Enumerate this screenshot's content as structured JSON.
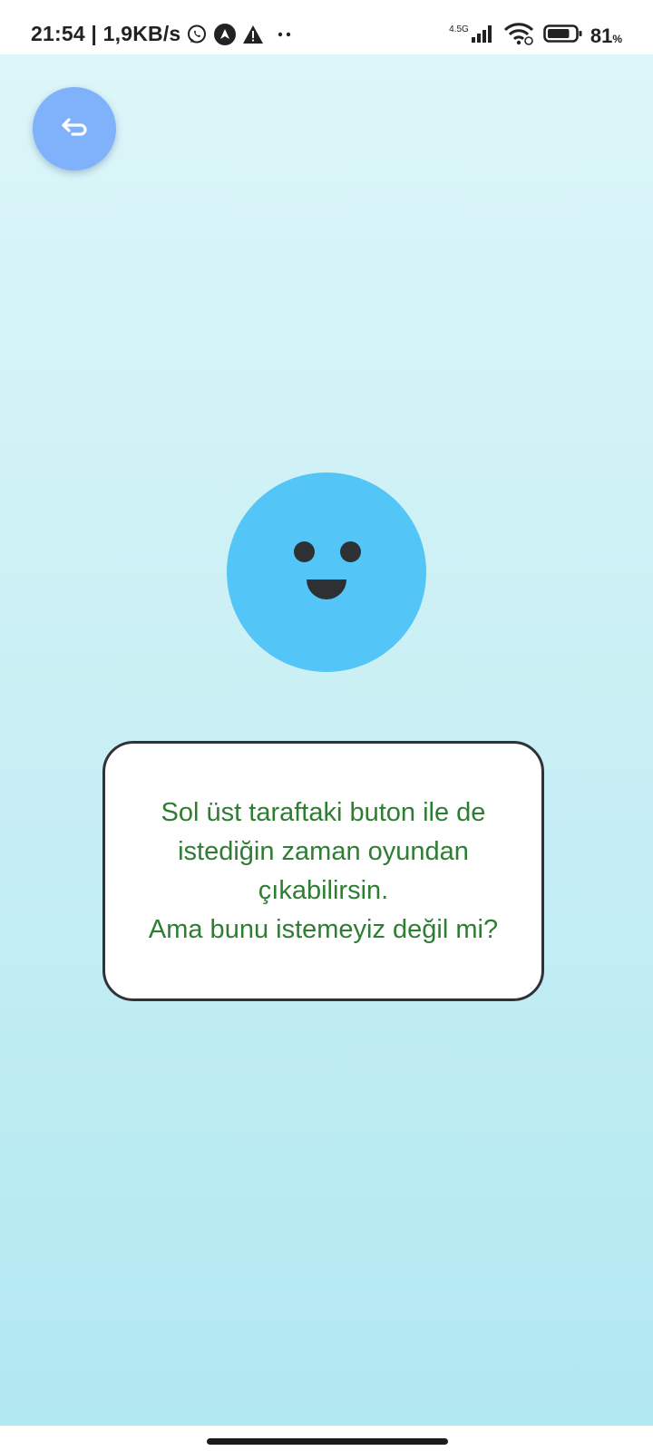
{
  "status_bar": {
    "time_speed": "21:54 | 1,9KB/s",
    "network_type": "4.5G",
    "battery_percent": "81",
    "battery_suffix": "%",
    "battery_level": 0.81,
    "icons": [
      "whatsapp-icon",
      "navigation-icon",
      "warning-icon",
      "more-dots-icon",
      "signal-icon",
      "wifi-icon",
      "battery-icon"
    ]
  },
  "app": {
    "back_button_icon": "return-arrow-icon",
    "mascot": "smiley-face",
    "message_line_1": "Sol üst taraftaki buton ile de istediğin zaman oyundan çıkabilirsin.",
    "message_line_2": "Ama bunu istemeyiz değil mi?"
  },
  "colors": {
    "background_top": "#dcf6f9",
    "background_bottom": "#b2e8f1",
    "back_button": "#80b2fb",
    "mascot": "#54c5f7",
    "message_text": "#2e7d32",
    "card_border": "#2f3338"
  }
}
